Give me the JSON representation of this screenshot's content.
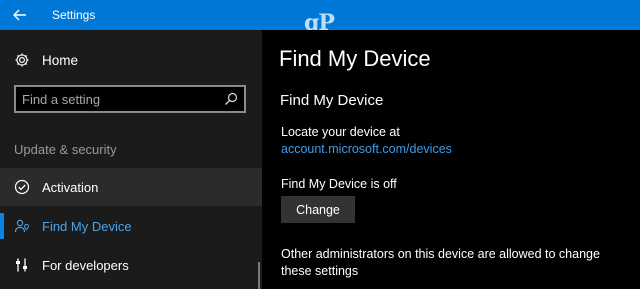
{
  "window": {
    "title": "Settings",
    "watermark": "gP"
  },
  "sidebar": {
    "home_label": "Home",
    "search_placeholder": "Find a setting",
    "section_label": "Update & security",
    "items": [
      {
        "label": "Activation",
        "icon": "check-circle-icon"
      },
      {
        "label": "Find My Device",
        "icon": "person-location-icon",
        "selected": true
      },
      {
        "label": "For developers",
        "icon": "sliders-icon"
      }
    ]
  },
  "main": {
    "page_title": "Find My Device",
    "sub_title": "Find My Device",
    "locate_text": "Locate your device at",
    "locate_link": "account.microsoft.com/devices",
    "status_text": "Find My Device is off",
    "change_button": "Change",
    "admins_text": "Other administrators on this device are allowed to change these settings"
  },
  "colors": {
    "accent": "#0078d7",
    "link": "#3f9be6",
    "sidebar_bg": "#1b1b1b",
    "selected_item_bg": "#2b2b2b"
  }
}
